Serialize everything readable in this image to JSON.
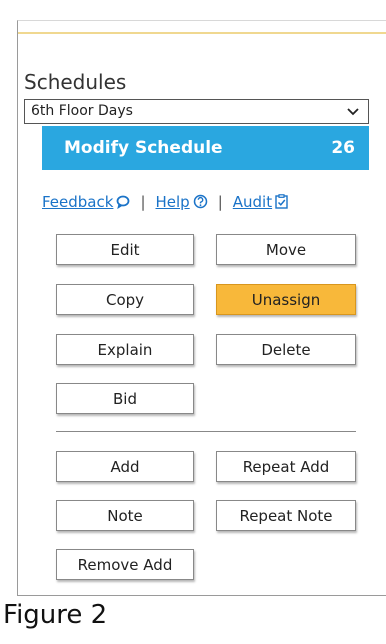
{
  "section": {
    "title": "Schedules",
    "schedule_select": {
      "value": "6th Floor Days"
    }
  },
  "banner": {
    "title": "Modify Schedule",
    "count": "26",
    "color": "#2aa7e0"
  },
  "links": [
    {
      "label": "Feedback",
      "icon": "speech-bubble-icon"
    },
    {
      "label": "Help",
      "icon": "question-circle-icon"
    },
    {
      "label": "Audit",
      "icon": "clipboard-check-icon"
    }
  ],
  "link_separator": "|",
  "buttons": {
    "edit": "Edit",
    "move": "Move",
    "copy": "Copy",
    "unassign": "Unassign",
    "explain": "Explain",
    "delete": "Delete",
    "bid": "Bid",
    "add": "Add",
    "repeat_add": "Repeat Add",
    "note": "Note",
    "repeat_note": "Repeat Note",
    "remove_add": "Remove Add"
  },
  "active_button_color": "#f8b83a",
  "figure_caption": "Figure 2"
}
